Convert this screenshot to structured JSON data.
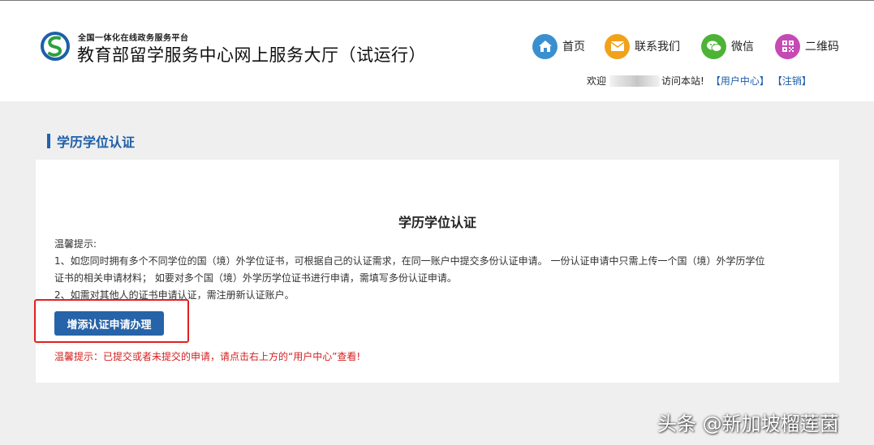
{
  "header": {
    "subtitle": "全国一体化在线政务服务平台",
    "title": "教育部留学服务中心网上服务大厅（试运行）",
    "nav": [
      {
        "label": "首页",
        "icon": "home-icon",
        "color": "#3a8fcf"
      },
      {
        "label": "联系我们",
        "icon": "mail-icon",
        "color": "#f0a21c"
      },
      {
        "label": "微信",
        "icon": "wechat-icon",
        "color": "#4db336"
      },
      {
        "label": "二维码",
        "icon": "qrcode-icon",
        "color": "#c54ab4"
      }
    ],
    "user": {
      "welcome": "欢迎",
      "visit": "访问本站!",
      "user_center": "【用户中心】",
      "logout": "【注销】"
    }
  },
  "section": {
    "title": "学历学位认证"
  },
  "panel": {
    "title": "学历学位认证",
    "tip_label": "温馨提示:",
    "tip1_line1": "1、如您同时拥有多个不同学位的国（境）外学位证书，可根据自己的认证需求，在同一账户中提交多份认证申请。 一份认证申请中只需上传一个国（境）外学历学位",
    "tip1_line2": "证书的相关申请材料； 如要对多个国（境）外学历学位证书进行申请，需填写多份认证申请。",
    "tip2": "2、如需对其他人的证书申请认证，需注册新认证账户。",
    "button": "增添认证申请办理",
    "red_tip": "温馨提示：已提交或者未提交的申请，请点击右上方的“用户中心”查看!"
  },
  "watermark": "头条 @新加坡榴莲菌",
  "colors": {
    "accent": "#2663a8",
    "link": "#1e5ea8",
    "warning": "#d41f1f",
    "highlight_box": "#e02020"
  }
}
